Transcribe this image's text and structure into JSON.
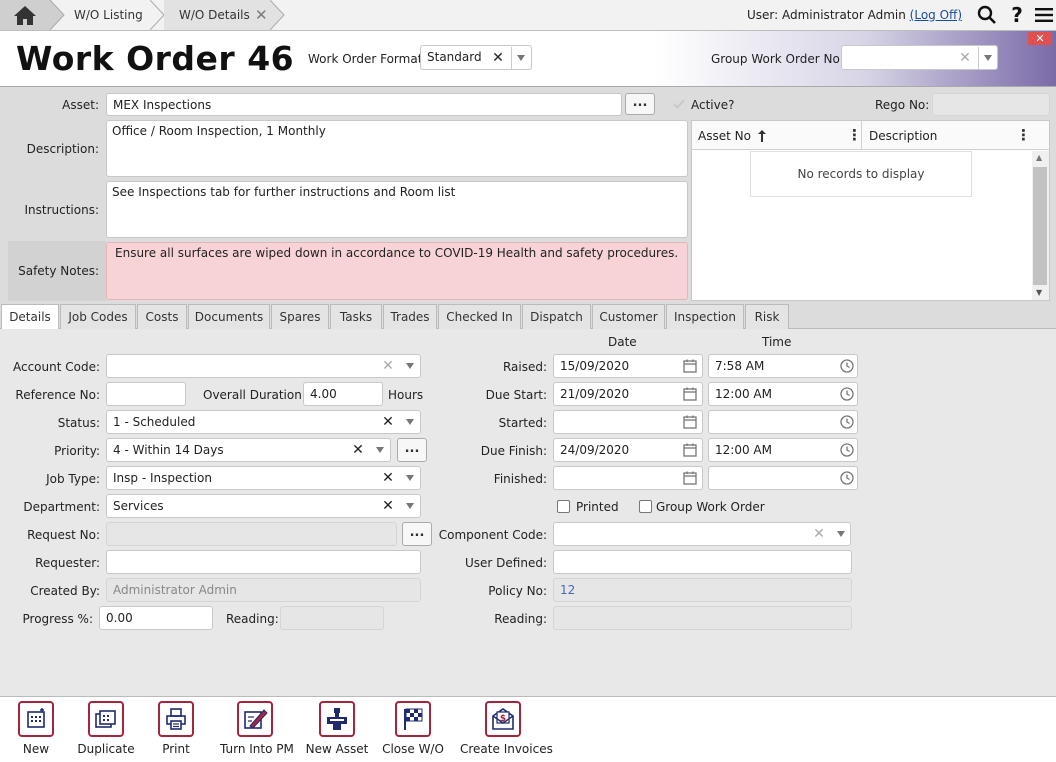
{
  "nav": {
    "crumbs": [
      "W/O Listing",
      "W/O Details"
    ],
    "user_label": "User: Administrator Admin",
    "logoff": "(Log Off)"
  },
  "header": {
    "title": "Work Order 46",
    "format_label": "Work Order Format",
    "format_value": "Standard",
    "group_label": "Group Work Order No:",
    "group_value": ""
  },
  "info": {
    "asset_label": "Asset:",
    "asset_value": "MEX Inspections",
    "asset_btn": "...",
    "active_label": "Active?",
    "rego_label": "Rego No:",
    "rego_value": "",
    "description_label": "Description:",
    "description_value": "Office / Room Inspection, 1 Monthly",
    "instructions_label": "Instructions:",
    "instructions_value": "See Inspections tab for further instructions and Room list",
    "safety_label": "Safety Notes:",
    "safety_value": "Ensure all surfaces are wiped down in accordance to COVID-19 Health and safety procedures."
  },
  "grid": {
    "columns": [
      "Asset No",
      "Description"
    ],
    "empty": "No records to display"
  },
  "tabs": [
    "Details",
    "Job Codes",
    "Costs",
    "Documents",
    "Spares",
    "Tasks",
    "Trades",
    "Checked In",
    "Dispatch",
    "Customer",
    "Inspection",
    "Risk"
  ],
  "details": {
    "account_code_label": "Account Code:",
    "account_code_value": "",
    "reference_label": "Reference No:",
    "reference_value": "",
    "duration_label": "Overall Duration:",
    "duration_value": "4.00",
    "duration_unit": "Hours",
    "status_label": "Status:",
    "status_value": "1 - Scheduled",
    "priority_label": "Priority:",
    "priority_value": "4 - Within 14 Days",
    "jobtype_label": "Job Type:",
    "jobtype_value": "Insp - Inspection",
    "department_label": "Department:",
    "department_value": "Services",
    "request_label": "Request No:",
    "request_value": "",
    "requester_label": "Requester:",
    "requester_value": "",
    "createdby_label": "Created By:",
    "createdby_value": "Administrator Admin",
    "progress_label": "Progress %:",
    "progress_value": "0.00",
    "reading_label": "Reading:",
    "reading_value": "",
    "date_header": "Date",
    "time_header": "Time",
    "raised_label": "Raised:",
    "raised_date": "15/09/2020",
    "raised_time": "7:58 AM",
    "duestart_label": "Due Start:",
    "duestart_date": "21/09/2020",
    "duestart_time": "12:00 AM",
    "started_label": "Started:",
    "started_date": "",
    "started_time": "",
    "duefinish_label": "Due Finish:",
    "duefinish_date": "24/09/2020",
    "duefinish_time": "12:00 AM",
    "finished_label": "Finished:",
    "finished_date": "",
    "finished_time": "",
    "printed_label": "Printed",
    "groupwo_label": "Group Work Order",
    "component_label": "Component Code:",
    "component_value": "",
    "userdef_label": "User Defined:",
    "userdef_value": "",
    "policy_label": "Policy No:",
    "policy_value": "12",
    "reading2_label": "Reading:",
    "reading2_value": ""
  },
  "toolbar": {
    "new": "New",
    "duplicate": "Duplicate",
    "print": "Print",
    "turn_into_pm": "Turn Into PM",
    "new_asset": "New Asset",
    "close_wo": "Close W/O",
    "create_invoices": "Create Invoices"
  },
  "colors": {
    "accent": "#a8233c",
    "safety_bg": "#f7d3d6",
    "header_gradient_end": "#7a6aa8"
  }
}
